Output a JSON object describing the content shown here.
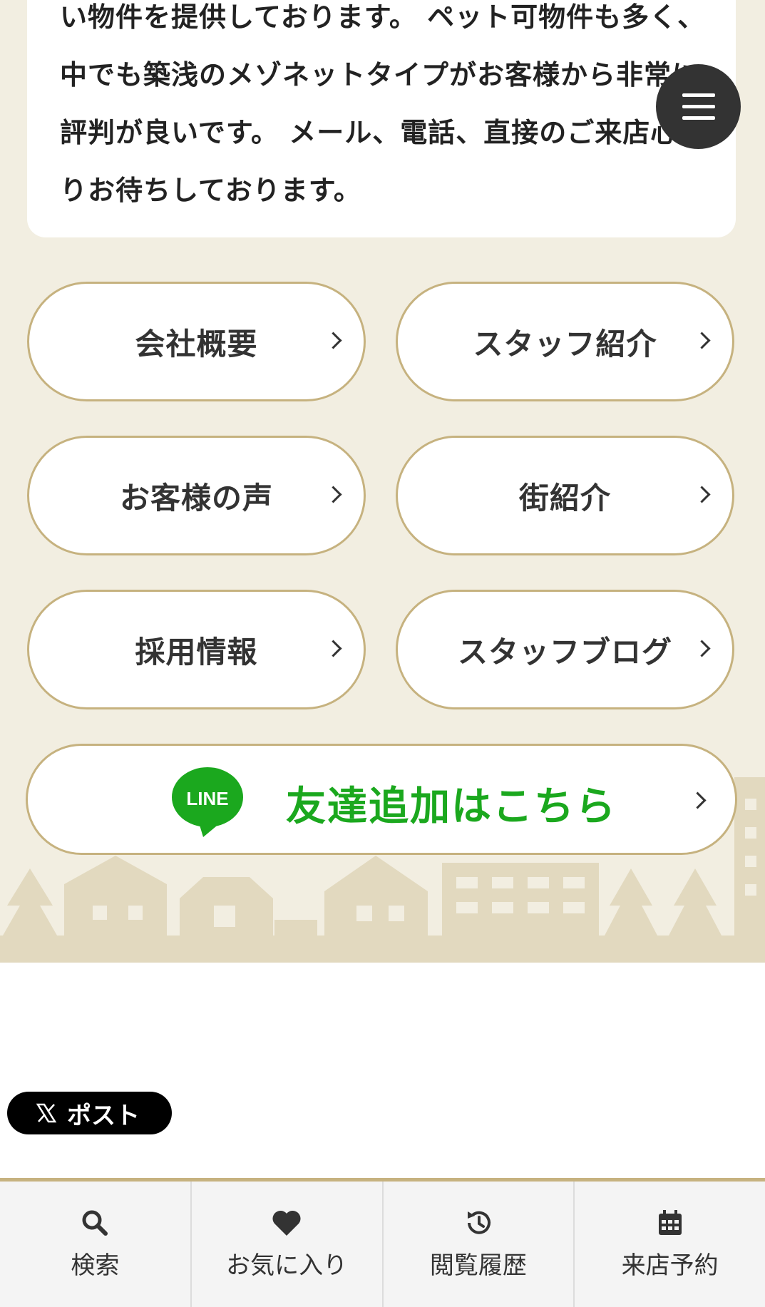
{
  "intro": {
    "text": "い物件を提供しております。 ペット可物件も多く、中でも築浅のメゾネットタイプがお客様から非常に評判が良いです。 メール、電話、直接のご来店心よりお待ちしております。"
  },
  "nav_buttons": [
    {
      "label": "会社概要"
    },
    {
      "label": "スタッフ紹介"
    },
    {
      "label": "お客様の声"
    },
    {
      "label": "街紹介"
    },
    {
      "label": "採用情報"
    },
    {
      "label": "スタッフブログ"
    }
  ],
  "line": {
    "logo_text": "LINE",
    "label": "友達追加はこちら",
    "color": "#1ba81e"
  },
  "share": {
    "x_label": "ポスト"
  },
  "bottom_nav": [
    {
      "label": "検索",
      "icon": "search-icon"
    },
    {
      "label": "お気に入り",
      "icon": "heart-icon"
    },
    {
      "label": "閲覧履歴",
      "icon": "history-icon"
    },
    {
      "label": "来店予約",
      "icon": "calendar-icon"
    }
  ],
  "colors": {
    "beige_bg": "#f2eee1",
    "gold_border": "#c6b27f",
    "dark": "#333333"
  }
}
